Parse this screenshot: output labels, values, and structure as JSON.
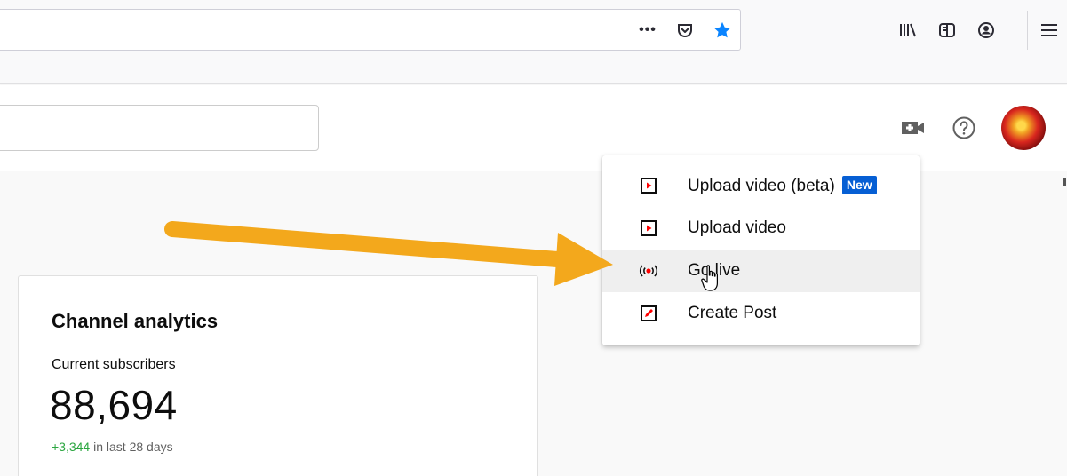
{
  "browser": {
    "url_actions": [
      "more-actions-icon",
      "pocket-icon",
      "bookmark-star-icon"
    ],
    "toolbar_icons": [
      "library-icon",
      "sidebar-icon",
      "account-icon",
      "menu-icon"
    ],
    "page_actions_label": "•••",
    "bookmark_color": "#0a84ff"
  },
  "header": {
    "icons": [
      "create-video-icon",
      "help-icon",
      "avatar"
    ]
  },
  "create_menu": {
    "items": [
      {
        "label": "Upload video (beta)",
        "badge": "New",
        "icon": "upload-video-icon"
      },
      {
        "label": "Upload video",
        "icon": "upload-video-icon"
      },
      {
        "label": "Go live",
        "icon": "go-live-icon",
        "hovered": true
      },
      {
        "label": "Create Post",
        "icon": "create-post-icon"
      }
    ],
    "badge_color": "#065fd4",
    "icon_accent": "#ff0000"
  },
  "analytics": {
    "title": "Channel analytics",
    "subscribers_label": "Current subscribers",
    "subscribers_value": "88,694",
    "change_value": "+3,344",
    "change_suffix": " in last 28 days",
    "change_color": "#2ba640"
  },
  "annotation": {
    "arrow_color": "#f3a81c"
  }
}
